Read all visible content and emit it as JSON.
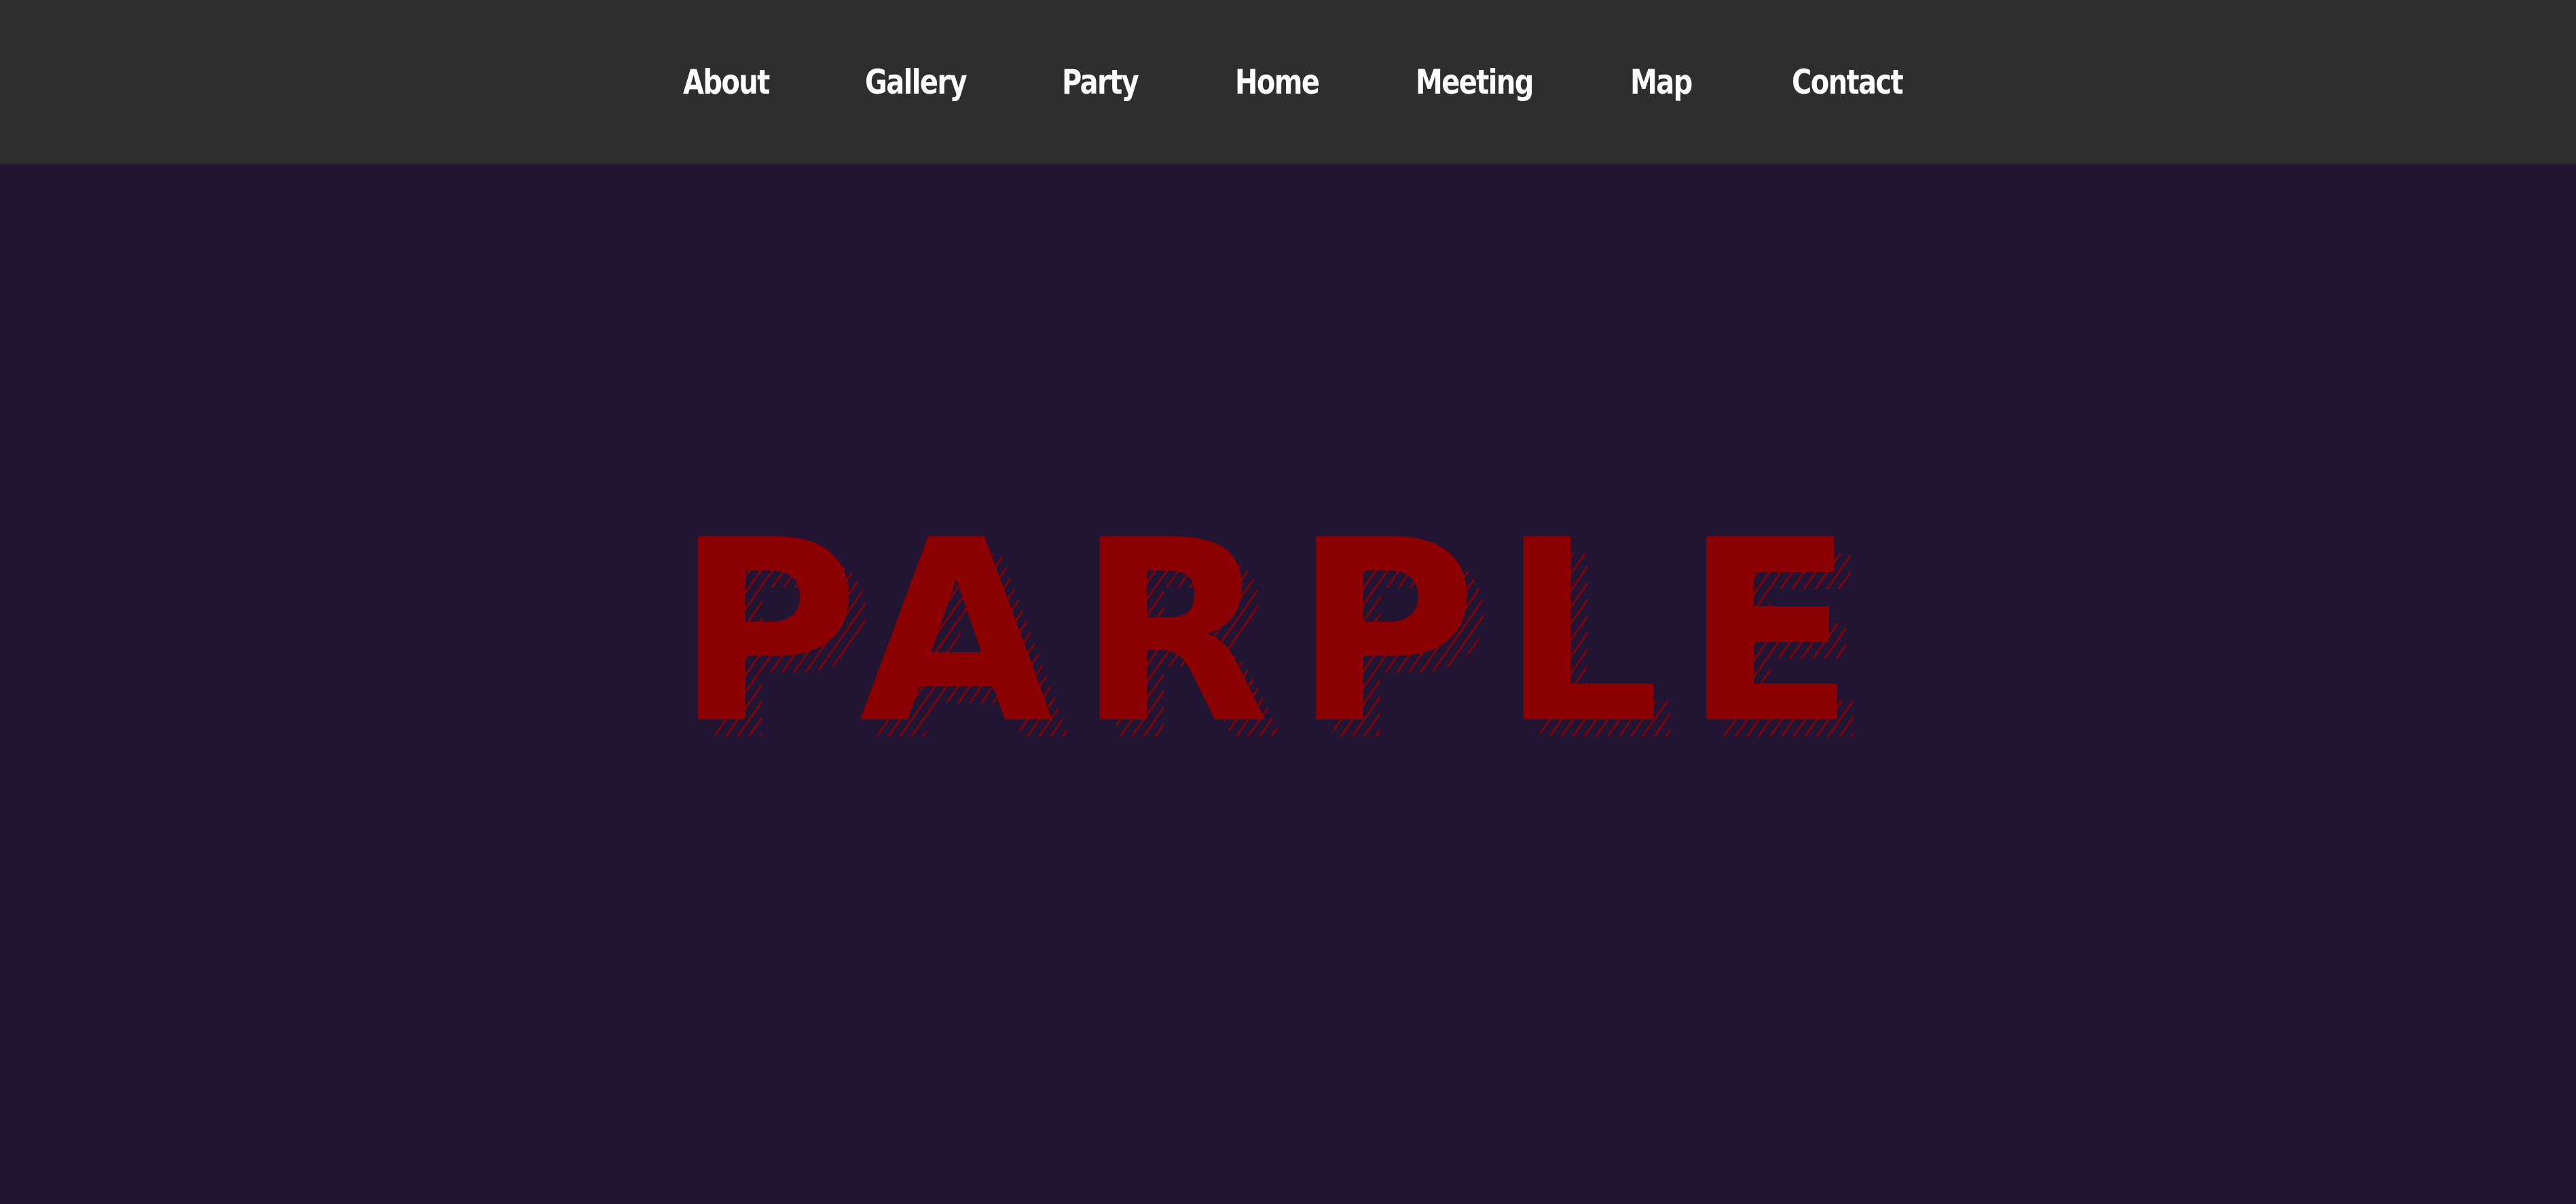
{
  "nav": {
    "items": [
      {
        "label": "About"
      },
      {
        "label": "Gallery"
      },
      {
        "label": "Party"
      },
      {
        "label": "Home"
      },
      {
        "label": "Meeting"
      },
      {
        "label": "Map"
      },
      {
        "label": "Contact"
      }
    ]
  },
  "hero": {
    "title": "PARPLE"
  },
  "colors": {
    "navbar_bg": "#2e2e2e",
    "page_bg": "#221433",
    "nav_text": "#ffffff",
    "hero_text": "#8b0000"
  }
}
